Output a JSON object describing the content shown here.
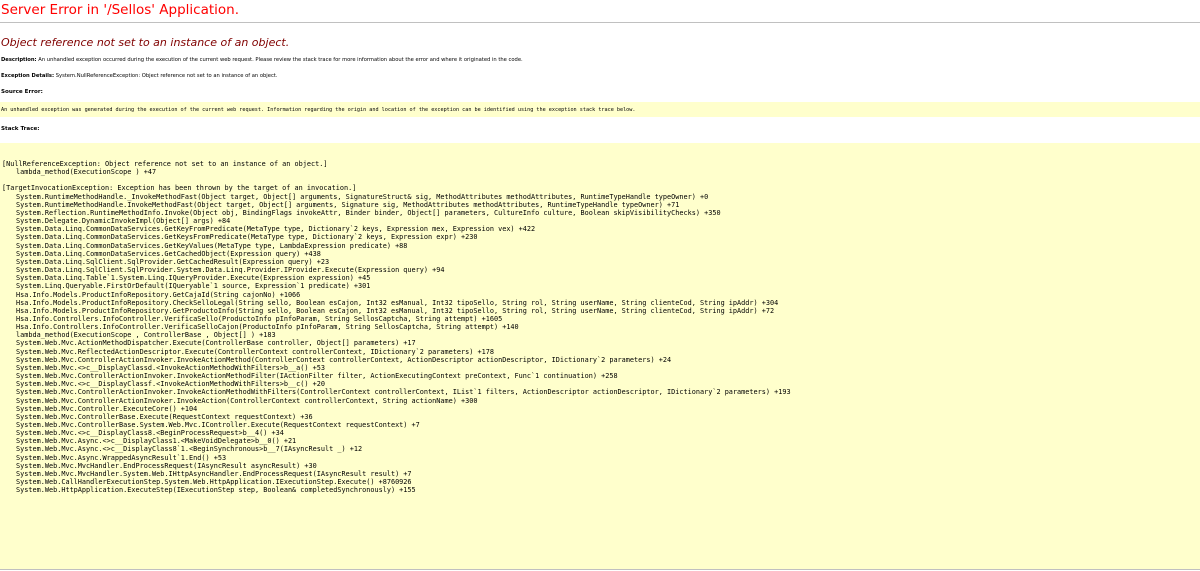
{
  "page": {
    "title": "Server Error in '/Sellos' Application.",
    "subtitle": "Object reference not set to an instance of an object.",
    "description_label": "Description:",
    "description_text": "An unhandled exception occurred during the execution of the current web request. Please review the stack trace for more information about the error and where it originated in the code.",
    "exception_label": "Exception Details:",
    "exception_text": "System.NullReferenceException: Object reference not set to an instance of an object.",
    "source_error_heading": "Source Error:",
    "source_error_text": "An unhandled exception was generated during the execution of the current web request. Information regarding the origin and location of the exception can be identified using the exception stack trace below.",
    "stack_trace_heading": "Stack Trace:"
  },
  "colors": {
    "title": "#ff0000",
    "subtitle": "#800000",
    "box_background": "#ffffcc",
    "divider": "#c0c0c0"
  },
  "stack_trace": [
    {
      "text": "[NullReferenceException: Object reference not set to an instance of an object.]",
      "indent": false
    },
    {
      "text": "lambda_method(ExecutionScope ) +47",
      "indent": true
    },
    {
      "text": "",
      "indent": false
    },
    {
      "text": "[TargetInvocationException: Exception has been thrown by the target of an invocation.]",
      "indent": false
    },
    {
      "text": "System.RuntimeMethodHandle._InvokeMethodFast(Object target, Object[] arguments, SignatureStruct& sig, MethodAttributes methodAttributes, RuntimeTypeHandle typeOwner) +0",
      "indent": true
    },
    {
      "text": "System.RuntimeMethodHandle.InvokeMethodFast(Object target, Object[] arguments, Signature sig, MethodAttributes methodAttributes, RuntimeTypeHandle typeOwner) +71",
      "indent": true
    },
    {
      "text": "System.Reflection.RuntimeMethodInfo.Invoke(Object obj, BindingFlags invokeAttr, Binder binder, Object[] parameters, CultureInfo culture, Boolean skipVisibilityChecks) +350",
      "indent": true
    },
    {
      "text": "System.Delegate.DynamicInvokeImpl(Object[] args) +84",
      "indent": true
    },
    {
      "text": "System.Data.Linq.CommonDataServices.GetKeyFromPredicate(MetaType type, Dictionary`2 keys, Expression mex, Expression vex) +422",
      "indent": true
    },
    {
      "text": "System.Data.Linq.CommonDataServices.GetKeysFromPredicate(MetaType type, Dictionary`2 keys, Expression expr) +230",
      "indent": true
    },
    {
      "text": "System.Data.Linq.CommonDataServices.GetKeyValues(MetaType type, LambdaExpression predicate) +88",
      "indent": true
    },
    {
      "text": "System.Data.Linq.CommonDataServices.GetCachedObject(Expression query) +438",
      "indent": true
    },
    {
      "text": "System.Data.Linq.SqlClient.SqlProvider.GetCachedResult(Expression query) +23",
      "indent": true
    },
    {
      "text": "System.Data.Linq.SqlClient.SqlProvider.System.Data.Linq.Provider.IProvider.Execute(Expression query) +94",
      "indent": true
    },
    {
      "text": "System.Data.Linq.Table`1.System.Linq.IQueryProvider.Execute(Expression expression) +45",
      "indent": true
    },
    {
      "text": "System.Linq.Queryable.FirstOrDefault(IQueryable`1 source, Expression`1 predicate) +301",
      "indent": true
    },
    {
      "text": "Hsa.Info.Models.ProductInfoRepository.GetCajaId(String cajonNo) +1066",
      "indent": true
    },
    {
      "text": "Hsa.Info.Models.ProductInfoRepository.CheckSelloLegal(String sello, Boolean esCajon, Int32 esManual, Int32 tipoSello, String rol, String userName, String clienteCod, String ipAddr) +304",
      "indent": true
    },
    {
      "text": "Hsa.Info.Models.ProductInfoRepository.GetProductoInfo(String sello, Boolean esCajon, Int32 esManual, Int32 tipoSello, String rol, String userName, String clienteCod, String ipAddr) +72",
      "indent": true
    },
    {
      "text": "Hsa.Info.Controllers.InfoController.VerificaSello(ProductoInfo pInfoParam, String SellosCaptcha, String attempt) +1605",
      "indent": true
    },
    {
      "text": "Hsa.Info.Controllers.InfoController.VerificaSelloCajon(ProductoInfo pInfoParam, String SellosCaptcha, String attempt) +140",
      "indent": true
    },
    {
      "text": "lambda_method(ExecutionScope , ControllerBase , Object[] ) +183",
      "indent": true
    },
    {
      "text": "System.Web.Mvc.ActionMethodDispatcher.Execute(ControllerBase controller, Object[] parameters) +17",
      "indent": true
    },
    {
      "text": "System.Web.Mvc.ReflectedActionDescriptor.Execute(ControllerContext controllerContext, IDictionary`2 parameters) +178",
      "indent": true
    },
    {
      "text": "System.Web.Mvc.ControllerActionInvoker.InvokeActionMethod(ControllerContext controllerContext, ActionDescriptor actionDescriptor, IDictionary`2 parameters) +24",
      "indent": true
    },
    {
      "text": "System.Web.Mvc.<>c__DisplayClassd.<InvokeActionMethodWithFilters>b__a() +53",
      "indent": true
    },
    {
      "text": "System.Web.Mvc.ControllerActionInvoker.InvokeActionMethodFilter(IActionFilter filter, ActionExecutingContext preContext, Func`1 continuation) +258",
      "indent": true
    },
    {
      "text": "System.Web.Mvc.<>c__DisplayClassf.<InvokeActionMethodWithFilters>b__c() +20",
      "indent": true
    },
    {
      "text": "System.Web.Mvc.ControllerActionInvoker.InvokeActionMethodWithFilters(ControllerContext controllerContext, IList`1 filters, ActionDescriptor actionDescriptor, IDictionary`2 parameters) +193",
      "indent": true
    },
    {
      "text": "System.Web.Mvc.ControllerActionInvoker.InvokeAction(ControllerContext controllerContext, String actionName) +300",
      "indent": true
    },
    {
      "text": "System.Web.Mvc.Controller.ExecuteCore() +104",
      "indent": true
    },
    {
      "text": "System.Web.Mvc.ControllerBase.Execute(RequestContext requestContext) +36",
      "indent": true
    },
    {
      "text": "System.Web.Mvc.ControllerBase.System.Web.Mvc.IController.Execute(RequestContext requestContext) +7",
      "indent": true
    },
    {
      "text": "System.Web.Mvc.<>c__DisplayClass8.<BeginProcessRequest>b__4() +34",
      "indent": true
    },
    {
      "text": "System.Web.Mvc.Async.<>c__DisplayClass1.<MakeVoidDelegate>b__0() +21",
      "indent": true
    },
    {
      "text": "System.Web.Mvc.Async.<>c__DisplayClass8`1.<BeginSynchronous>b__7(IAsyncResult _) +12",
      "indent": true
    },
    {
      "text": "System.Web.Mvc.Async.WrappedAsyncResult`1.End() +53",
      "indent": true
    },
    {
      "text": "System.Web.Mvc.MvcHandler.EndProcessRequest(IAsyncResult asyncResult) +30",
      "indent": true
    },
    {
      "text": "System.Web.Mvc.MvcHandler.System.Web.IHttpAsyncHandler.EndProcessRequest(IAsyncResult result) +7",
      "indent": true
    },
    {
      "text": "System.Web.CallHandlerExecutionStep.System.Web.HttpApplication.IExecutionStep.Execute() +8760926",
      "indent": true
    },
    {
      "text": "System.Web.HttpApplication.ExecuteStep(IExecutionStep step, Boolean& completedSynchronously) +155",
      "indent": true
    }
  ]
}
